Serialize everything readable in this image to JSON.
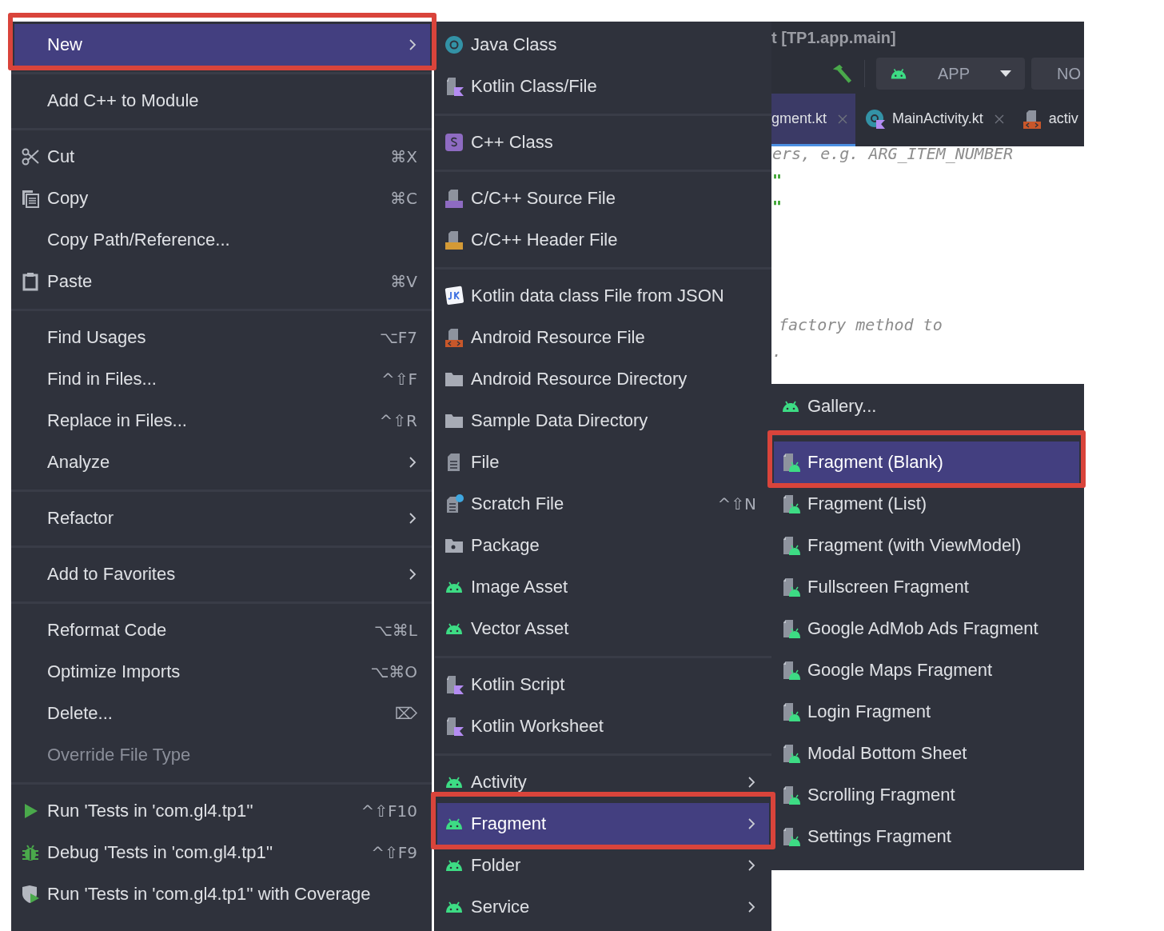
{
  "editor": {
    "title": "t [TP1.app.main]",
    "run_config": {
      "label": "APP"
    },
    "device": {
      "label": "NO"
    },
    "tabs": [
      {
        "label": "gment.kt",
        "kind": "plain",
        "selected": true,
        "closable": true
      },
      {
        "label": "MainActivity.kt",
        "kind": "kotlin-class",
        "selected": false,
        "closable": true
      },
      {
        "label": "activ",
        "kind": "resource-file",
        "selected": false,
        "closable": false
      }
    ],
    "code_lines": [
      {
        "text": "ers, e.g. ARG_ITEM_NUMBER",
        "kind": "comment"
      },
      {
        "text": "\"",
        "kind": "string"
      },
      {
        "text": "\"",
        "kind": "string"
      },
      {
        "text": "factory method to",
        "kind": "comment"
      },
      {
        "text": ".",
        "kind": "comment"
      }
    ]
  },
  "context_menu": {
    "items": [
      {
        "kind": "plain",
        "label": "New",
        "submenu": true,
        "selected": true,
        "disabled": false
      },
      {
        "kind": "separator"
      },
      {
        "kind": "plain",
        "label": "Add C++ to Module",
        "submenu": false,
        "selected": false,
        "disabled": false
      },
      {
        "kind": "separator"
      },
      {
        "kind": "scissors",
        "label": "Cut",
        "shortcut": "⌘X",
        "submenu": false,
        "selected": false,
        "disabled": false
      },
      {
        "kind": "copy",
        "label": "Copy",
        "shortcut": "⌘C",
        "submenu": false,
        "selected": false,
        "disabled": false
      },
      {
        "kind": "plain",
        "label": "Copy Path/Reference...",
        "submenu": false,
        "selected": false,
        "disabled": false
      },
      {
        "kind": "clipboard",
        "label": "Paste",
        "shortcut": "⌘V",
        "submenu": false,
        "selected": false,
        "disabled": false
      },
      {
        "kind": "separator"
      },
      {
        "kind": "plain",
        "label": "Find Usages",
        "shortcut": "⌥F7",
        "submenu": false,
        "selected": false,
        "disabled": false
      },
      {
        "kind": "plain",
        "label": "Find in Files...",
        "shortcut": "^⇧F",
        "submenu": false,
        "selected": false,
        "disabled": false
      },
      {
        "kind": "plain",
        "label": "Replace in Files...",
        "shortcut": "^⇧R",
        "submenu": false,
        "selected": false,
        "disabled": false
      },
      {
        "kind": "plain",
        "label": "Analyze",
        "submenu": true,
        "selected": false,
        "disabled": false
      },
      {
        "kind": "separator"
      },
      {
        "kind": "plain",
        "label": "Refactor",
        "submenu": true,
        "selected": false,
        "disabled": false
      },
      {
        "kind": "separator"
      },
      {
        "kind": "plain",
        "label": "Add to Favorites",
        "submenu": true,
        "selected": false,
        "disabled": false
      },
      {
        "kind": "separator"
      },
      {
        "kind": "plain",
        "label": "Reformat Code",
        "shortcut": "⌥⌘L",
        "submenu": false,
        "selected": false,
        "disabled": false
      },
      {
        "kind": "plain",
        "label": "Optimize Imports",
        "shortcut": "⌥⌘O",
        "submenu": false,
        "selected": false,
        "disabled": false
      },
      {
        "kind": "plain",
        "label": "Delete...",
        "shortcut": "⌦",
        "submenu": false,
        "selected": false,
        "disabled": false
      },
      {
        "kind": "plain",
        "label": "Override File Type",
        "submenu": false,
        "selected": false,
        "disabled": true
      },
      {
        "kind": "separator"
      },
      {
        "kind": "play",
        "label": "Run 'Tests in 'com.gl4.tp1''",
        "shortcut": "^⇧F10",
        "submenu": false,
        "selected": false,
        "disabled": false
      },
      {
        "kind": "bug",
        "label": "Debug 'Tests in 'com.gl4.tp1''",
        "shortcut": "^⇧F9",
        "submenu": false,
        "selected": false,
        "disabled": false
      },
      {
        "kind": "shield-play",
        "label": "Run 'Tests in 'com.gl4.tp1'' with Coverage",
        "submenu": false,
        "selected": false,
        "disabled": false
      }
    ]
  },
  "new_menu": {
    "items": [
      {
        "kind": "java-class",
        "label": "Java Class",
        "submenu": false,
        "selected": false,
        "disabled": false
      },
      {
        "kind": "kotlin-file",
        "label": "Kotlin Class/File",
        "submenu": false,
        "selected": false,
        "disabled": false
      },
      {
        "kind": "separator"
      },
      {
        "kind": "cpp-class",
        "label": "C++ Class",
        "submenu": false,
        "selected": false,
        "disabled": false
      },
      {
        "kind": "separator"
      },
      {
        "kind": "source-file",
        "label": "C/C++ Source File",
        "submenu": false,
        "selected": false,
        "disabled": false
      },
      {
        "kind": "header-file",
        "label": "C/C++ Header File",
        "submenu": false,
        "selected": false,
        "disabled": false
      },
      {
        "kind": "separator"
      },
      {
        "kind": "json-badge",
        "label": "Kotlin data class File from JSON",
        "submenu": false,
        "selected": false,
        "disabled": false
      },
      {
        "kind": "resource-file",
        "label": "Android Resource File",
        "submenu": false,
        "selected": false,
        "disabled": false
      },
      {
        "kind": "folder",
        "label": "Android Resource Directory",
        "submenu": false,
        "selected": false,
        "disabled": false
      },
      {
        "kind": "folder",
        "label": "Sample Data Directory",
        "submenu": false,
        "selected": false,
        "disabled": false
      },
      {
        "kind": "file",
        "label": "File",
        "submenu": false,
        "selected": false,
        "disabled": false
      },
      {
        "kind": "scratch-file",
        "label": "Scratch File",
        "shortcut": "^⇧N",
        "submenu": false,
        "selected": false,
        "disabled": false
      },
      {
        "kind": "package",
        "label": "Package",
        "submenu": false,
        "selected": false,
        "disabled": false
      },
      {
        "kind": "android",
        "label": "Image Asset",
        "submenu": false,
        "selected": false,
        "disabled": false
      },
      {
        "kind": "android",
        "label": "Vector Asset",
        "submenu": false,
        "selected": false,
        "disabled": false
      },
      {
        "kind": "separator"
      },
      {
        "kind": "kotlin-file",
        "label": "Kotlin Script",
        "submenu": false,
        "selected": false,
        "disabled": false
      },
      {
        "kind": "kotlin-file",
        "label": "Kotlin Worksheet",
        "submenu": false,
        "selected": false,
        "disabled": false
      },
      {
        "kind": "separator"
      },
      {
        "kind": "android",
        "label": "Activity",
        "submenu": true,
        "selected": false,
        "disabled": false
      },
      {
        "kind": "android",
        "label": "Fragment",
        "submenu": true,
        "selected": true,
        "disabled": false
      },
      {
        "kind": "android",
        "label": "Folder",
        "submenu": true,
        "selected": false,
        "disabled": false
      },
      {
        "kind": "android",
        "label": "Service",
        "submenu": true,
        "selected": false,
        "disabled": false
      }
    ]
  },
  "fragment_menu": {
    "items": [
      {
        "kind": "android",
        "label": "Gallery...",
        "submenu": false,
        "selected": false,
        "disabled": false
      },
      {
        "kind": "separator"
      },
      {
        "kind": "fragment-file",
        "label": "Fragment (Blank)",
        "submenu": false,
        "selected": true,
        "disabled": false
      },
      {
        "kind": "fragment-file",
        "label": "Fragment (List)",
        "submenu": false,
        "selected": false,
        "disabled": false
      },
      {
        "kind": "fragment-file",
        "label": "Fragment (with ViewModel)",
        "submenu": false,
        "selected": false,
        "disabled": false
      },
      {
        "kind": "fragment-file",
        "label": "Fullscreen Fragment",
        "submenu": false,
        "selected": false,
        "disabled": false
      },
      {
        "kind": "fragment-file",
        "label": "Google AdMob Ads Fragment",
        "submenu": false,
        "selected": false,
        "disabled": false
      },
      {
        "kind": "fragment-file",
        "label": "Google Maps Fragment",
        "submenu": false,
        "selected": false,
        "disabled": false
      },
      {
        "kind": "fragment-file",
        "label": "Login Fragment",
        "submenu": false,
        "selected": false,
        "disabled": false
      },
      {
        "kind": "fragment-file",
        "label": "Modal Bottom Sheet",
        "submenu": false,
        "selected": false,
        "disabled": false
      },
      {
        "kind": "fragment-file",
        "label": "Scrolling Fragment",
        "submenu": false,
        "selected": false,
        "disabled": false
      },
      {
        "kind": "fragment-file",
        "label": "Settings Fragment",
        "submenu": false,
        "selected": false,
        "disabled": false
      }
    ]
  }
}
